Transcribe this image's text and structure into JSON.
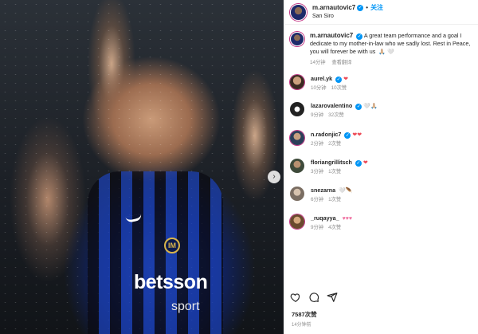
{
  "post": {
    "username": "m.arnautovic7",
    "follow_label": "关注",
    "location": "San Siro",
    "caption": "A great team performance and a goal I dedicate to my mother-in-law who we sadly lost. Rest in Peace, you will forever be with us",
    "caption_emoji": "🙏🏼 🤍",
    "caption_time": "14分钟",
    "see_translation": "查看翻译",
    "photo_sponsor": "betsson",
    "photo_sponsor_sub": "sport"
  },
  "comments": [
    {
      "user": "aurel.yk",
      "text": "❤",
      "text_class": "heart-red",
      "time": "10分钟",
      "likes": "10次赞"
    },
    {
      "user": "lazarovalentino",
      "text": "🤍🙏🏼",
      "text_class": "heart-white",
      "time": "9分钟",
      "likes": "32次赞"
    },
    {
      "user": "n.radonjic7",
      "text": "❤❤",
      "text_class": "heart-red",
      "time": "2分钟",
      "likes": "2次赞"
    },
    {
      "user": "floriangrillitsch",
      "text": "❤",
      "text_class": "heart-red",
      "time": "3分钟",
      "likes": "1次赞"
    },
    {
      "user": "snezarna",
      "text": "🤍🪶",
      "text_class": "heart-white",
      "time": "6分钟",
      "likes": "1次赞"
    },
    {
      "user": "_ruqayya_",
      "text": "♥♥♥",
      "text_class": "heart-pink",
      "time": "9分钟",
      "likes": "4次赞"
    }
  ],
  "footer": {
    "likes": "7587次赞",
    "time": "14分钟前"
  },
  "icons": {
    "like": "heart-icon",
    "comment": "comment-icon",
    "share": "share-icon",
    "next": "chevron-right-icon"
  },
  "colors": {
    "accent": "#0095f6",
    "heart_red": "#ed4956",
    "meta_gray": "#8e8e8e"
  }
}
